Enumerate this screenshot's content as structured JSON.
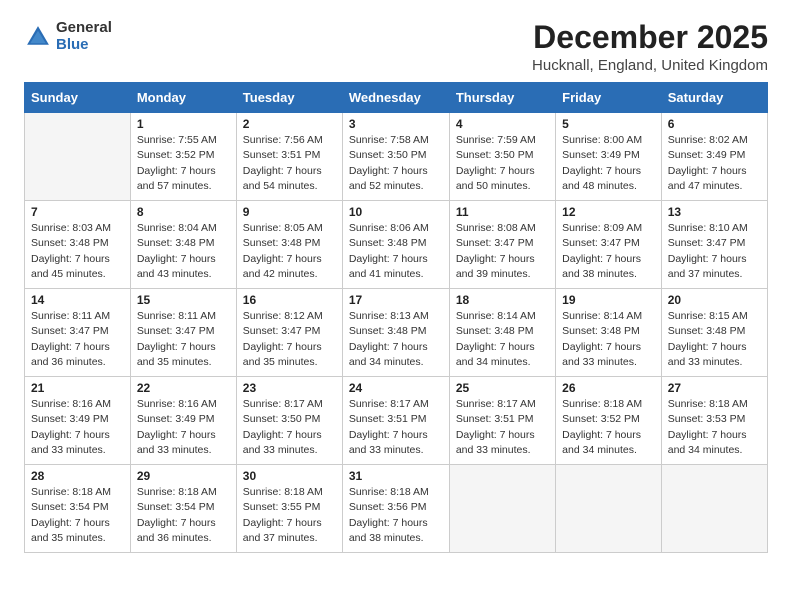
{
  "logo": {
    "general": "General",
    "blue": "Blue"
  },
  "title": "December 2025",
  "subtitle": "Hucknall, England, United Kingdom",
  "days_of_week": [
    "Sunday",
    "Monday",
    "Tuesday",
    "Wednesday",
    "Thursday",
    "Friday",
    "Saturday"
  ],
  "weeks": [
    [
      {
        "day": "",
        "info": ""
      },
      {
        "day": "1",
        "info": "Sunrise: 7:55 AM\nSunset: 3:52 PM\nDaylight: 7 hours\nand 57 minutes."
      },
      {
        "day": "2",
        "info": "Sunrise: 7:56 AM\nSunset: 3:51 PM\nDaylight: 7 hours\nand 54 minutes."
      },
      {
        "day": "3",
        "info": "Sunrise: 7:58 AM\nSunset: 3:50 PM\nDaylight: 7 hours\nand 52 minutes."
      },
      {
        "day": "4",
        "info": "Sunrise: 7:59 AM\nSunset: 3:50 PM\nDaylight: 7 hours\nand 50 minutes."
      },
      {
        "day": "5",
        "info": "Sunrise: 8:00 AM\nSunset: 3:49 PM\nDaylight: 7 hours\nand 48 minutes."
      },
      {
        "day": "6",
        "info": "Sunrise: 8:02 AM\nSunset: 3:49 PM\nDaylight: 7 hours\nand 47 minutes."
      }
    ],
    [
      {
        "day": "7",
        "info": "Sunrise: 8:03 AM\nSunset: 3:48 PM\nDaylight: 7 hours\nand 45 minutes."
      },
      {
        "day": "8",
        "info": "Sunrise: 8:04 AM\nSunset: 3:48 PM\nDaylight: 7 hours\nand 43 minutes."
      },
      {
        "day": "9",
        "info": "Sunrise: 8:05 AM\nSunset: 3:48 PM\nDaylight: 7 hours\nand 42 minutes."
      },
      {
        "day": "10",
        "info": "Sunrise: 8:06 AM\nSunset: 3:48 PM\nDaylight: 7 hours\nand 41 minutes."
      },
      {
        "day": "11",
        "info": "Sunrise: 8:08 AM\nSunset: 3:47 PM\nDaylight: 7 hours\nand 39 minutes."
      },
      {
        "day": "12",
        "info": "Sunrise: 8:09 AM\nSunset: 3:47 PM\nDaylight: 7 hours\nand 38 minutes."
      },
      {
        "day": "13",
        "info": "Sunrise: 8:10 AM\nSunset: 3:47 PM\nDaylight: 7 hours\nand 37 minutes."
      }
    ],
    [
      {
        "day": "14",
        "info": "Sunrise: 8:11 AM\nSunset: 3:47 PM\nDaylight: 7 hours\nand 36 minutes."
      },
      {
        "day": "15",
        "info": "Sunrise: 8:11 AM\nSunset: 3:47 PM\nDaylight: 7 hours\nand 35 minutes."
      },
      {
        "day": "16",
        "info": "Sunrise: 8:12 AM\nSunset: 3:47 PM\nDaylight: 7 hours\nand 35 minutes."
      },
      {
        "day": "17",
        "info": "Sunrise: 8:13 AM\nSunset: 3:48 PM\nDaylight: 7 hours\nand 34 minutes."
      },
      {
        "day": "18",
        "info": "Sunrise: 8:14 AM\nSunset: 3:48 PM\nDaylight: 7 hours\nand 34 minutes."
      },
      {
        "day": "19",
        "info": "Sunrise: 8:14 AM\nSunset: 3:48 PM\nDaylight: 7 hours\nand 33 minutes."
      },
      {
        "day": "20",
        "info": "Sunrise: 8:15 AM\nSunset: 3:48 PM\nDaylight: 7 hours\nand 33 minutes."
      }
    ],
    [
      {
        "day": "21",
        "info": "Sunrise: 8:16 AM\nSunset: 3:49 PM\nDaylight: 7 hours\nand 33 minutes."
      },
      {
        "day": "22",
        "info": "Sunrise: 8:16 AM\nSunset: 3:49 PM\nDaylight: 7 hours\nand 33 minutes."
      },
      {
        "day": "23",
        "info": "Sunrise: 8:17 AM\nSunset: 3:50 PM\nDaylight: 7 hours\nand 33 minutes."
      },
      {
        "day": "24",
        "info": "Sunrise: 8:17 AM\nSunset: 3:51 PM\nDaylight: 7 hours\nand 33 minutes."
      },
      {
        "day": "25",
        "info": "Sunrise: 8:17 AM\nSunset: 3:51 PM\nDaylight: 7 hours\nand 33 minutes."
      },
      {
        "day": "26",
        "info": "Sunrise: 8:18 AM\nSunset: 3:52 PM\nDaylight: 7 hours\nand 34 minutes."
      },
      {
        "day": "27",
        "info": "Sunrise: 8:18 AM\nSunset: 3:53 PM\nDaylight: 7 hours\nand 34 minutes."
      }
    ],
    [
      {
        "day": "28",
        "info": "Sunrise: 8:18 AM\nSunset: 3:54 PM\nDaylight: 7 hours\nand 35 minutes."
      },
      {
        "day": "29",
        "info": "Sunrise: 8:18 AM\nSunset: 3:54 PM\nDaylight: 7 hours\nand 36 minutes."
      },
      {
        "day": "30",
        "info": "Sunrise: 8:18 AM\nSunset: 3:55 PM\nDaylight: 7 hours\nand 37 minutes."
      },
      {
        "day": "31",
        "info": "Sunrise: 8:18 AM\nSunset: 3:56 PM\nDaylight: 7 hours\nand 38 minutes."
      },
      {
        "day": "",
        "info": ""
      },
      {
        "day": "",
        "info": ""
      },
      {
        "day": "",
        "info": ""
      }
    ]
  ]
}
